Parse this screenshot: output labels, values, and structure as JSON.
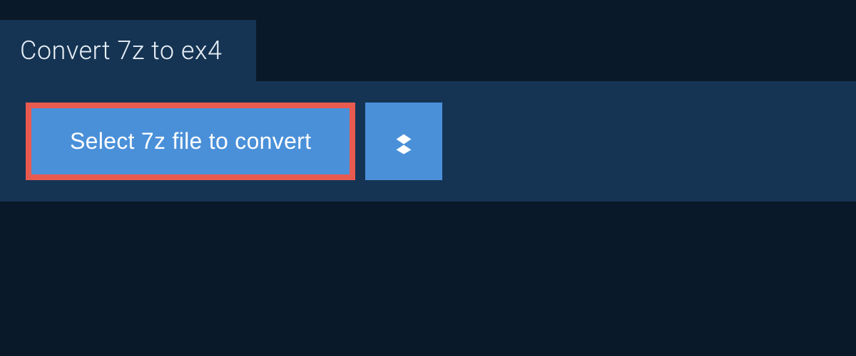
{
  "header": {
    "title": "Convert 7z to ex4"
  },
  "actions": {
    "select_file_label": "Select 7z file to convert"
  },
  "colors": {
    "background": "#0a1929",
    "panel": "#153453",
    "button": "#4a90d9",
    "highlight_border": "#e85a4f",
    "text_light": "#e8eef5",
    "text_white": "#ffffff"
  }
}
